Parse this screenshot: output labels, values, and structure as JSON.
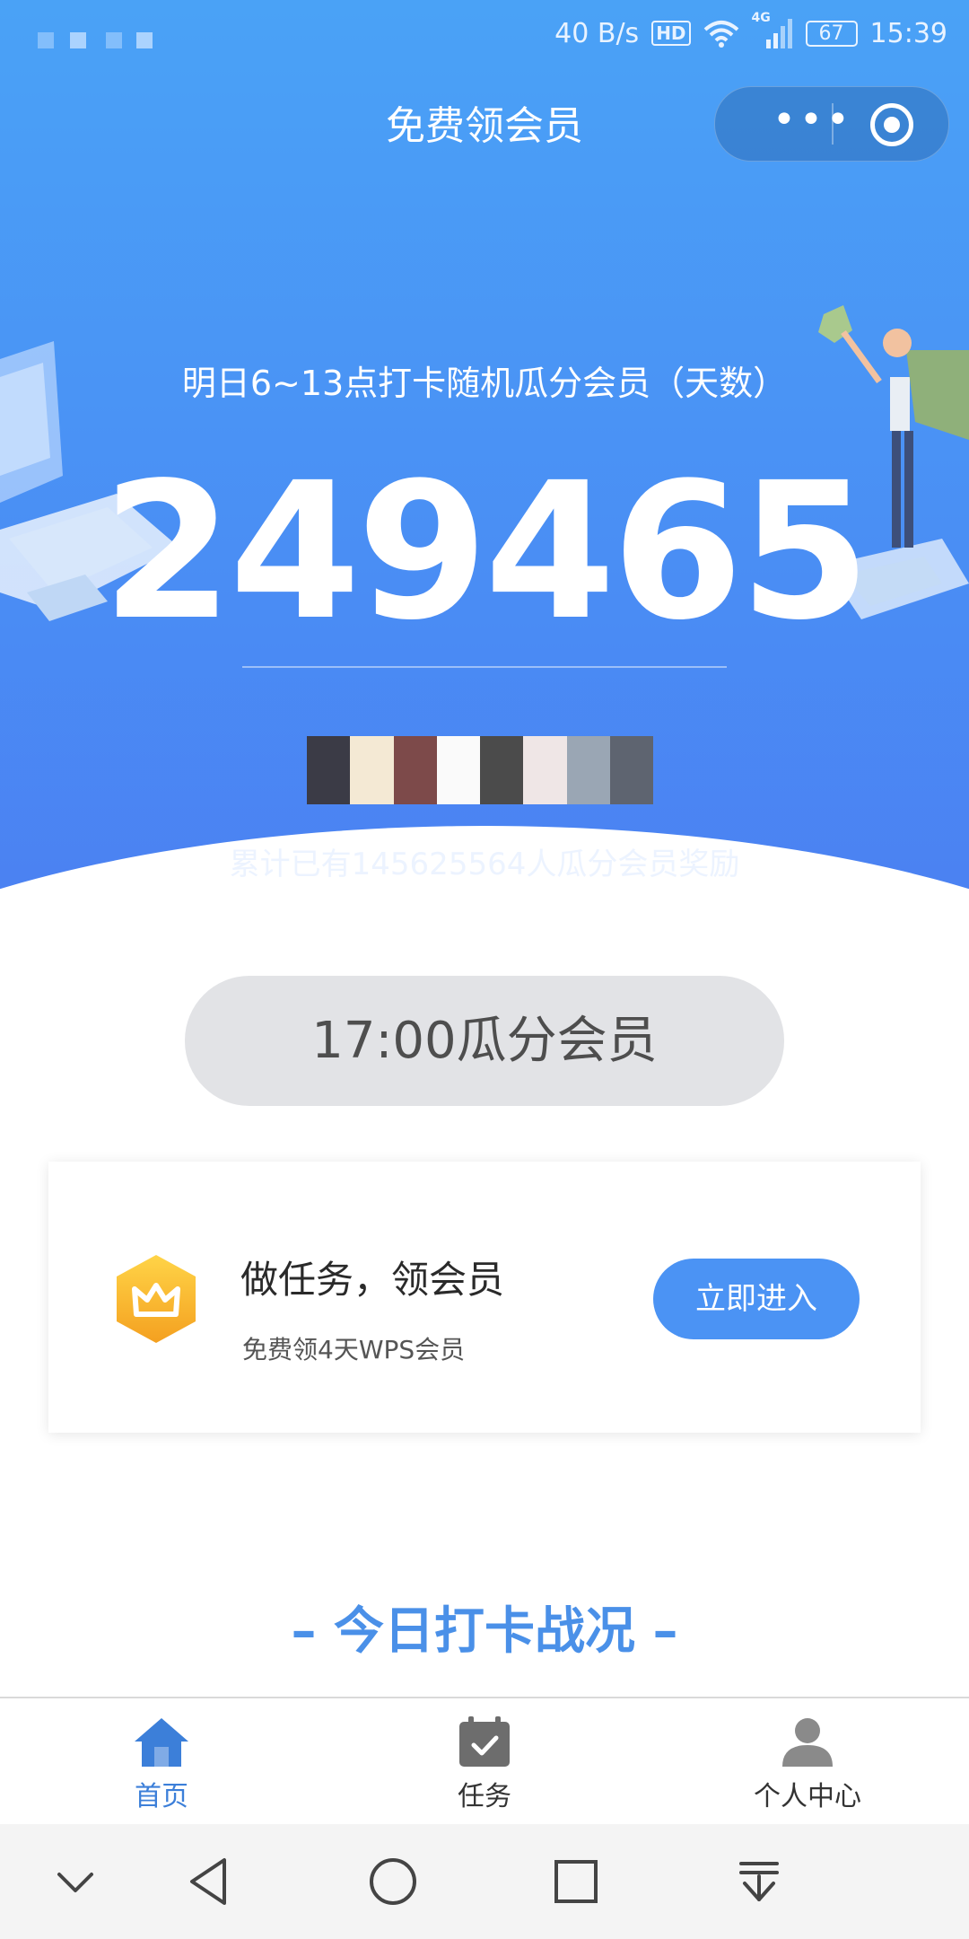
{
  "status_bar": {
    "net_speed": "40 B/s",
    "hd_label": "HD",
    "signal_label": "4G",
    "battery": "67",
    "time": "15:39"
  },
  "header": {
    "title": "免费领会员",
    "more_icon": "more-dots-icon",
    "close_icon": "target-icon"
  },
  "hero": {
    "subtitle": "明日6~13点打卡随机瓜分会员（天数）",
    "count": "249465",
    "total_text": "累计已有145625564人瓜分会员奖励",
    "colors": {
      "top": "#4aa2f6",
      "bottom": "#4b80f2"
    }
  },
  "timer_button": {
    "label": "17:00瓜分会员"
  },
  "task_card": {
    "icon": "crown-hex-icon",
    "title": "做任务，领会员",
    "subtitle": "免费领4天WPS会员",
    "button_label": "立即进入",
    "accent": "#4b93f4"
  },
  "section": {
    "title": "– 今日打卡战况 –"
  },
  "tabbar": {
    "tabs": [
      {
        "label": "首页",
        "icon": "home-icon",
        "active": true
      },
      {
        "label": "任务",
        "icon": "calendar-check-icon",
        "active": false
      },
      {
        "label": "个人中心",
        "icon": "person-icon",
        "active": false
      }
    ],
    "active_color": "#3c7fd9",
    "inactive_color": "#333333"
  },
  "navbar": {
    "buttons": [
      "chevron-down-icon",
      "back-triangle-icon",
      "home-circle-icon",
      "recents-square-icon",
      "download-icon"
    ]
  }
}
